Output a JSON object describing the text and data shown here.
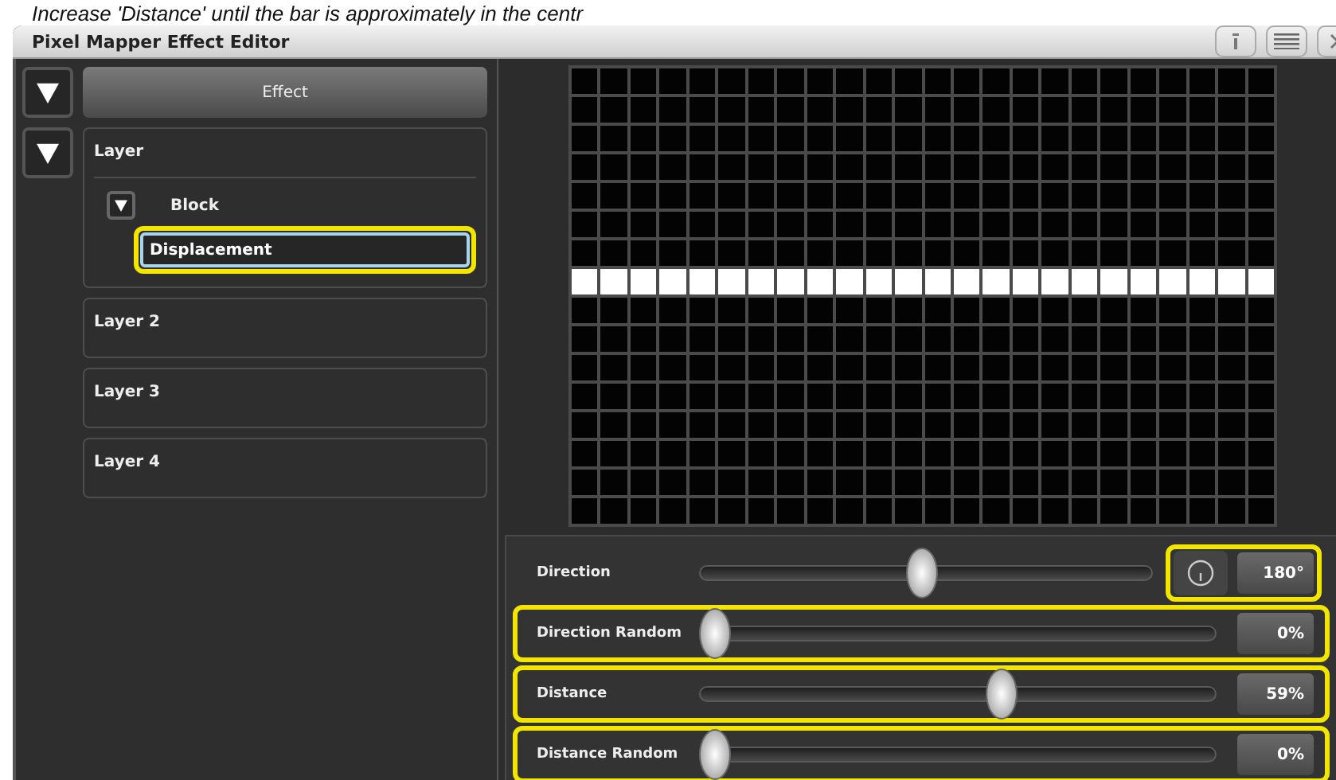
{
  "caption": "Increase 'Distance' until the bar is approximately in the centr",
  "window": {
    "title": "Pixel Mapper Effect Editor"
  },
  "title_buttons": [
    {
      "kind": "info"
    },
    {
      "kind": "menu"
    },
    {
      "kind": "close"
    }
  ],
  "tree": [
    {
      "label": "Effect",
      "kind": "header",
      "expanded": true
    },
    {
      "label": "Layer",
      "kind": "group",
      "expanded": true,
      "children": [
        {
          "label": "Block",
          "expanded": true,
          "children": [
            {
              "label": "Displacement",
              "selected": true,
              "highlighted": true
            }
          ]
        }
      ]
    },
    {
      "label": "Layer 2",
      "kind": "group"
    },
    {
      "label": "Layer 3",
      "kind": "group"
    },
    {
      "label": "Layer 4",
      "kind": "group"
    }
  ],
  "grid": {
    "rows": [
      {
        "lit": false
      },
      {
        "lit": false
      },
      {
        "lit": false
      },
      {
        "lit": false
      },
      {
        "lit": false
      },
      {
        "lit": false
      },
      {
        "lit": false
      },
      {
        "lit": true
      },
      {
        "lit": false
      },
      {
        "lit": false
      },
      {
        "lit": false
      },
      {
        "lit": false
      },
      {
        "lit": false
      },
      {
        "lit": false
      },
      {
        "lit": false
      },
      {
        "lit": false
      }
    ]
  },
  "sliders": [
    {
      "label": "Direction",
      "kind": "dial",
      "level": 0.49,
      "value": "180°",
      "highlighted": true
    },
    {
      "label": "Direction Random",
      "kind": "plain",
      "level": 0,
      "value": "0%",
      "highlighted": true
    },
    {
      "label": "Distance",
      "kind": "plain",
      "level": 0.59,
      "value": "59%",
      "highlighted": true
    },
    {
      "label": "Distance Random",
      "kind": "plain",
      "level": 0,
      "value": "0%",
      "highlighted": true
    }
  ]
}
